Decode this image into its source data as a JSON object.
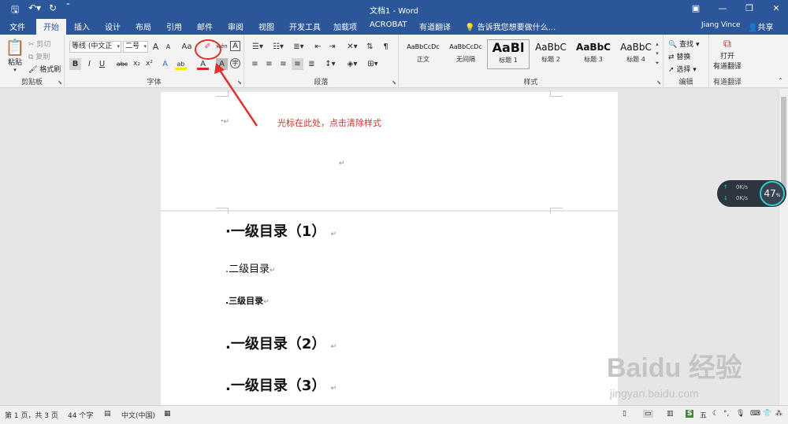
{
  "window": {
    "title": "文档1 - Word",
    "user": "Jiang Vince",
    "share_label": "共享",
    "accent_color": "#2b579a"
  },
  "quick_access": {
    "save_icon": "save-icon",
    "undo_icon": "undo-icon",
    "redo_icon": "redo-icon",
    "customize_icon": "customize-icon"
  },
  "tabs": [
    "文件",
    "开始",
    "插入",
    "设计",
    "布局",
    "引用",
    "邮件",
    "审阅",
    "视图",
    "开发工具",
    "加载项",
    "ACROBAT",
    "有道翻译"
  ],
  "active_tab": "开始",
  "tell_me": "告诉我您想要做什么...",
  "ribbon": {
    "clipboard": {
      "label": "剪贴板",
      "paste": "粘贴",
      "cut": "剪切",
      "copy": "复制",
      "format_painter": "格式刷"
    },
    "font": {
      "label": "字体",
      "font_name": "等线 (中文正",
      "font_size": "二号",
      "grow": "A",
      "shrink": "A",
      "change_case": "Aa",
      "clear_formatting_icon": "clear-formatting-icon",
      "phonetic": "wén",
      "border_char": "A",
      "bold": "B",
      "italic": "I",
      "underline": "U",
      "strikethrough": "abc",
      "subscript": "x₂",
      "superscript": "x²",
      "text_effect": "A",
      "highlight": "ab",
      "font_color": "A",
      "char_shading": "A",
      "enclose": "字"
    },
    "paragraph": {
      "label": "段落"
    },
    "styles": {
      "label": "样式",
      "items": [
        {
          "sample": "AaBbCcDc",
          "name": "正文"
        },
        {
          "sample": "AaBbCcDc",
          "name": "无间隔"
        },
        {
          "sample": "AaBl",
          "name": "标题 1"
        },
        {
          "sample": "AaBbC",
          "name": "标题 2"
        },
        {
          "sample": "AaBbC",
          "name": "标题 3"
        },
        {
          "sample": "AaBbC",
          "name": "标题 4"
        }
      ]
    },
    "editing": {
      "label": "编辑",
      "find": "查找",
      "replace": "替换",
      "select": "选择"
    },
    "youdao": {
      "label": "有道翻译",
      "open": "打开",
      "open2": "有道翻译"
    }
  },
  "document": {
    "annotation": "光标在此处，点击清除样式",
    "lines": [
      {
        "text": "·一级目录（1）",
        "style": "h1"
      },
      {
        "text": ".二级目录",
        "style": "h2"
      },
      {
        "text": ".三级目录",
        "style": "h3"
      },
      {
        "text": ".一级目录（2）",
        "style": "h1"
      },
      {
        "text": ".一级目录（3）",
        "style": "h1"
      }
    ],
    "paragraph_mark": "↵"
  },
  "net_widget": {
    "up": "0K/s",
    "down": "0K/s",
    "percent": "47",
    "percent_sign": "%"
  },
  "statusbar": {
    "page": "第 1 页，共 3 页",
    "words": "44 个字",
    "language": "中文(中国)"
  },
  "watermark": {
    "main": "Baidu 经验",
    "sub": "jingyan.baidu.com"
  }
}
